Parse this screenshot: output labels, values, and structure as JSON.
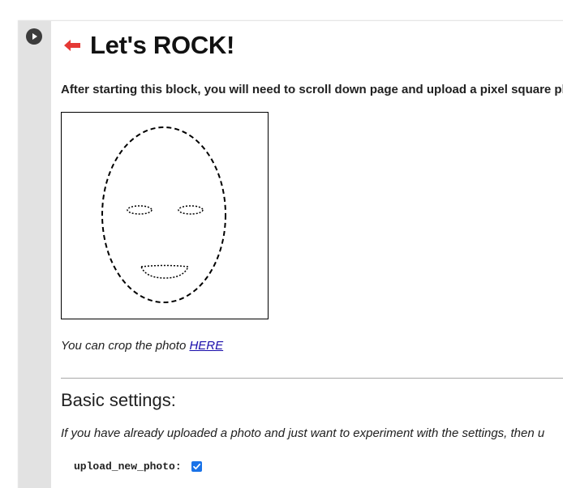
{
  "cell": {
    "run_icon": "play-icon",
    "title": "Let's ROCK!",
    "title_icon": "left-arrow-icon",
    "title_icon_color": "#e53935",
    "instruction": "After starting this block, you will need to scroll down page and upload a pixel square ph",
    "crop_text": "You can crop the photo ",
    "crop_link": "HERE",
    "section_heading": "Basic settings:",
    "note": "If you have already uploaded a photo and just want to experiment with the settings, then u",
    "params": [
      {
        "label": "upload_new_photo:",
        "checked": true
      }
    ]
  },
  "colors": {
    "gutter": "#e2e2e2",
    "run_button": "#3c3c3c",
    "link": "#1a0dab",
    "checkbox": "#1a73e8",
    "divider": "#a8a8a8"
  }
}
